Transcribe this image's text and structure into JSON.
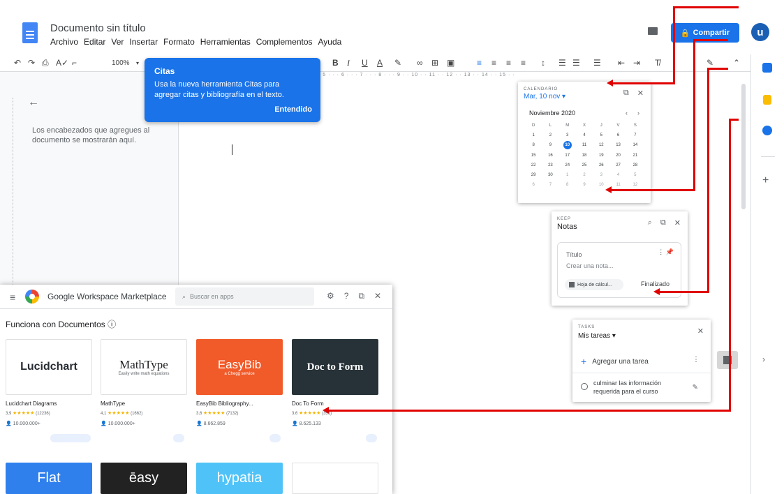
{
  "header": {
    "doc_title": "Documento sin título",
    "menu": [
      "Archivo",
      "Editar",
      "Ver",
      "Insertar",
      "Formato",
      "Herramientas",
      "Complementos",
      "Ayuda"
    ],
    "share_label": "Compartir",
    "avatar_letter": "u"
  },
  "toolbar": {
    "zoom": "100%",
    "buttons": [
      "undo-icon",
      "redo-icon",
      "print-icon",
      "spellcheck-icon",
      "paint-format-icon",
      "bold-icon",
      "italic-icon",
      "underline-icon",
      "text-color-icon",
      "highlight-icon",
      "link-icon",
      "comment-icon",
      "image-icon",
      "align-left-icon",
      "align-center-icon",
      "align-right-icon",
      "justify-icon",
      "line-spacing-icon",
      "checklist-icon",
      "bullet-list-icon",
      "numbered-list-icon",
      "decrease-indent-icon",
      "increase-indent-icon",
      "clear-format-icon",
      "edit-mode-icon",
      "collapse-icon"
    ]
  },
  "ruler_text": "· 5 · · · 6 · · · 7 · · · 8 · · · 9 · · 10 · · 11 · · 12 · · 13 · · 14 · · 15 · · 16 · · 17 · · 18 ·",
  "outline": {
    "text": "Los encabezados que agregues al documento se mostrarán aquí."
  },
  "tooltip": {
    "title": "Citas",
    "body": "Usa la nueva herramienta Citas para agregar citas y bibliografía en el texto.",
    "button": "Entendido"
  },
  "calendar": {
    "header": "CALENDARIO",
    "date": "Mar, 10 nov ▾",
    "month": "Noviembre 2020",
    "weekdays": [
      "D",
      "L",
      "M",
      "X",
      "J",
      "V",
      "S"
    ],
    "weeks": [
      [
        "1",
        "2",
        "3",
        "4",
        "5",
        "6",
        "7"
      ],
      [
        "8",
        "9",
        "10",
        "11",
        "12",
        "13",
        "14"
      ],
      [
        "15",
        "16",
        "17",
        "18",
        "19",
        "20",
        "21"
      ],
      [
        "22",
        "23",
        "24",
        "25",
        "26",
        "27",
        "28"
      ],
      [
        "29",
        "30",
        "1",
        "2",
        "3",
        "4",
        "5"
      ],
      [
        "6",
        "7",
        "8",
        "9",
        "10",
        "11",
        "12"
      ]
    ],
    "selected": "10"
  },
  "keep": {
    "header": "KEEP",
    "title": "Notas",
    "note_title_placeholder": "Título",
    "note_body_placeholder": "Crear una nota...",
    "chip": "Hoja de cálcul...",
    "done": "Finalizado"
  },
  "tasks": {
    "header": "TASKS",
    "list": "Mis tareas ▾",
    "add": "Agregar una tarea",
    "item": "culminar las información requerida para el curso"
  },
  "marketplace": {
    "title": "Google Workspace Marketplace",
    "search_placeholder": "Buscar en apps",
    "works_with": "Funciona con Documentos ⓘ",
    "apps": [
      {
        "name": "Lucidchart Diagrams",
        "rating": "3,9",
        "reviews": "(12236)",
        "installs": "10.000.000+",
        "logo": "Lucidchart"
      },
      {
        "name": "MathType",
        "rating": "4,1",
        "reviews": "(1662)",
        "installs": "10.000.000+",
        "logo": "MathType",
        "tagline": "Easily write math equations"
      },
      {
        "name": "EasyBib Bibliography...",
        "rating": "3,6",
        "reviews": "(7132)",
        "installs": "8.662.859",
        "logo": "EasyBib",
        "tagline": "a Chegg service"
      },
      {
        "name": "Doc To Form",
        "rating": "3,6",
        "reviews": "(351)",
        "installs": "8.625.133",
        "logo": "Doc to Form"
      }
    ],
    "row2": [
      "Flat",
      "ēasy",
      "hypatia",
      ""
    ]
  },
  "colors": {
    "accent": "#1a73e8",
    "arrow": "#e00000"
  }
}
